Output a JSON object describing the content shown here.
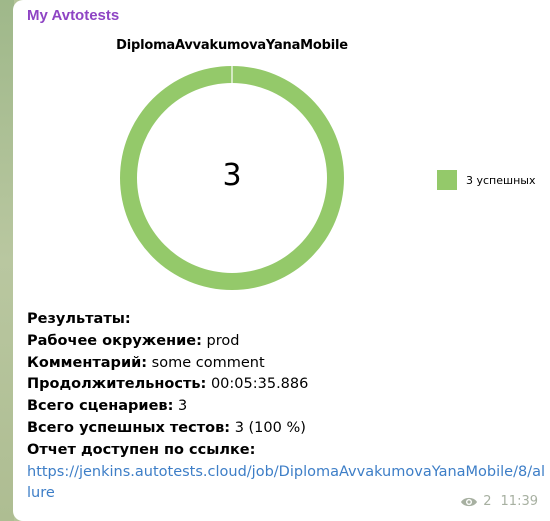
{
  "colors": {
    "sender": "#8e44c4",
    "chart_fill": "#94c96a",
    "link": "#3d7ec7",
    "meta": "#a7b0a1"
  },
  "message": {
    "sender": "My Avtotests",
    "results_heading": "Результаты:",
    "env_label": "Рабочее окружение:",
    "env_value": "prod",
    "comment_label": "Комментарий:",
    "comment_value": "some comment",
    "duration_label": "Продолжительность:",
    "duration_value": "00:05:35.886",
    "scenarios_label": "Всего сценариев:",
    "scenarios_value": "3",
    "passed_label": "Всего успешных тестов:",
    "passed_value": "3 (100 %)",
    "report_label": "Отчет доступен по ссылке:",
    "report_link": "https://jenkins.autotests.cloud/job/DiplomaAvvakumovaYanaMobile/8/allure",
    "view_icon": "eye-icon",
    "views": "2",
    "time": "11:39"
  },
  "chart_data": {
    "type": "pie",
    "title": "DiplomaAvvakumovaYanaMobile",
    "center_label": "3",
    "slices": [
      {
        "label": "3 успешных",
        "value": 3,
        "color": "#94c96a"
      }
    ],
    "legend_position": "right"
  }
}
